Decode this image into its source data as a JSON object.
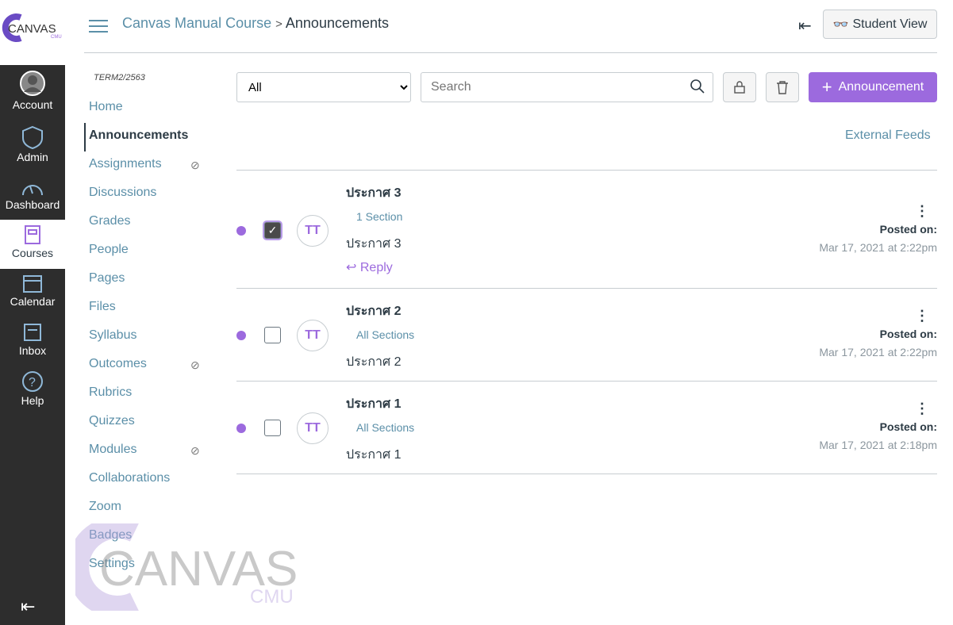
{
  "brand": {
    "logo_text": "CANVAS",
    "logo_sub": "CMU",
    "accent": "#9c6ade"
  },
  "global_nav": [
    {
      "label": "Account"
    },
    {
      "label": "Admin"
    },
    {
      "label": "Dashboard"
    },
    {
      "label": "Courses"
    },
    {
      "label": "Calendar"
    },
    {
      "label": "Inbox"
    },
    {
      "label": "Help"
    }
  ],
  "breadcrumb": {
    "course": "Canvas Manual Course",
    "sep": ">",
    "current": "Announcements"
  },
  "header": {
    "student_view": "Student View"
  },
  "course_nav": {
    "term": "TERM2/2563",
    "items": [
      "Home",
      "Announcements",
      "Assignments",
      "Discussions",
      "Grades",
      "People",
      "Pages",
      "Files",
      "Syllabus",
      "Outcomes",
      "Rubrics",
      "Quizzes",
      "Modules",
      "Collaborations",
      "Zoom",
      "Badges",
      "Settings"
    ]
  },
  "toolbar": {
    "filter": "All",
    "search_placeholder": "Search",
    "add_label": "Announcement",
    "external_feeds": "External Feeds"
  },
  "announcements": [
    {
      "title": "ประกาศ 3",
      "sections": "1 Section",
      "message": "ประกาศ 3",
      "author": "TT",
      "posted_label": "Posted on:",
      "date": "Mar 17, 2021 at 2:22pm",
      "reply": "Reply",
      "checked": true
    },
    {
      "title": "ประกาศ 2",
      "sections": "All Sections",
      "message": "ประกาศ 2",
      "author": "TT",
      "posted_label": "Posted on:",
      "date": "Mar 17, 2021 at 2:22pm"
    },
    {
      "title": "ประกาศ 1",
      "sections": "All Sections",
      "message": "ประกาศ 1",
      "author": "TT",
      "posted_label": "Posted on:",
      "date": "Mar 17, 2021 at 2:18pm"
    }
  ]
}
